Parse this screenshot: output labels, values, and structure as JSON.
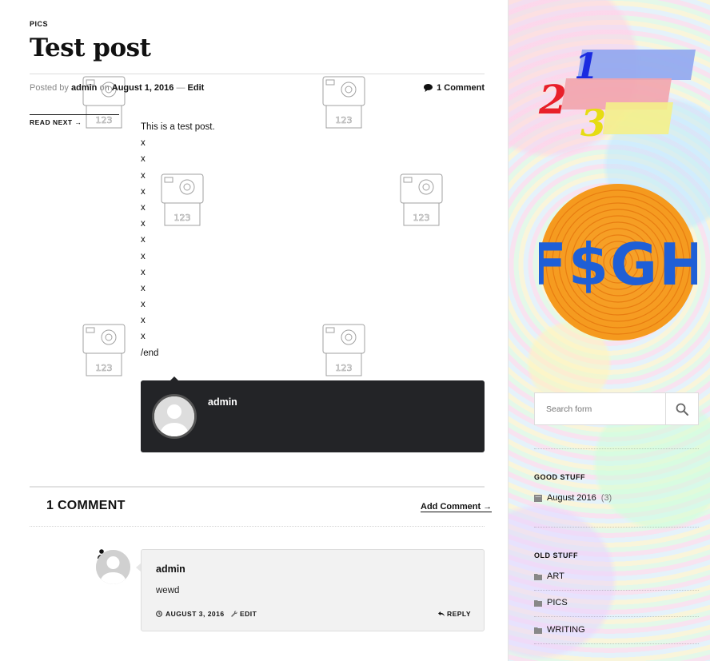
{
  "post": {
    "category": "PICS",
    "title": "Test post",
    "meta": {
      "posted_by_prefix": "Posted by",
      "author": "admin",
      "on": "on",
      "date": "August 1, 2016",
      "separator": "—",
      "edit": "Edit",
      "comments": "1 Comment"
    },
    "read_next": "READ NEXT →",
    "content_lines": [
      "This is a test post.",
      "x",
      "x",
      "x",
      "x",
      "x",
      "x",
      "x",
      "x",
      "x",
      "x",
      "x",
      "x",
      "x",
      "/end"
    ],
    "author_box": {
      "name": "admin"
    }
  },
  "comments": {
    "title": "1 COMMENT",
    "add_comment": "Add Comment →",
    "items": [
      {
        "author": "admin",
        "text": "wewd",
        "date": "AUGUST 3, 2016",
        "edit": "EDIT",
        "reply": "REPLY"
      }
    ]
  },
  "sidebar": {
    "search": {
      "placeholder": "Search form"
    },
    "good_stuff": {
      "title": "GOOD STUFF",
      "items": [
        {
          "label": "August 2016",
          "count": "(3)"
        }
      ]
    },
    "old_stuff": {
      "title": "OLD STUFF",
      "items": [
        {
          "label": "ART"
        },
        {
          "label": "PICS"
        },
        {
          "label": "WRITING"
        }
      ]
    },
    "logo_text": {
      "one": "1",
      "two": "2",
      "three": "3",
      "fsgh": "F$GH"
    }
  },
  "colors": {
    "author_box_bg": "#232427",
    "fsgh_orange": "#f7a22a",
    "fsgh_blue": "#1f5fd6"
  },
  "icons": [
    "comment-icon",
    "clock-icon",
    "wrench-icon",
    "reply-icon",
    "search-icon",
    "user-icon",
    "folder-icon",
    "archive-icon",
    "camera-watermark-icon"
  ]
}
